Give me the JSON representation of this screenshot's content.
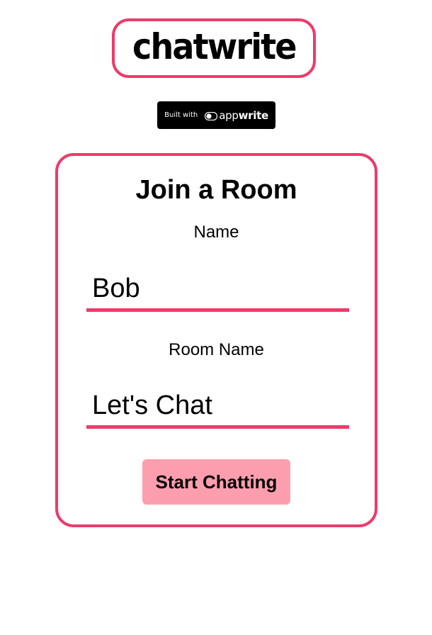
{
  "header": {
    "logo_text": "chatwrite"
  },
  "badge": {
    "built_with": "Built with",
    "brand_light": "app",
    "brand_bold": "write",
    "icon": "appwrite-logo-icon"
  },
  "card": {
    "title": "Join a Room",
    "name_label": "Name",
    "name_value": "Bob",
    "room_label": "Room Name",
    "room_value": "Let's Chat",
    "submit_label": "Start Chatting"
  },
  "colors": {
    "accent": "#ee3a6a",
    "button_bg": "#fd9eae",
    "badge_bg": "#000000",
    "background": "#ffffff"
  }
}
